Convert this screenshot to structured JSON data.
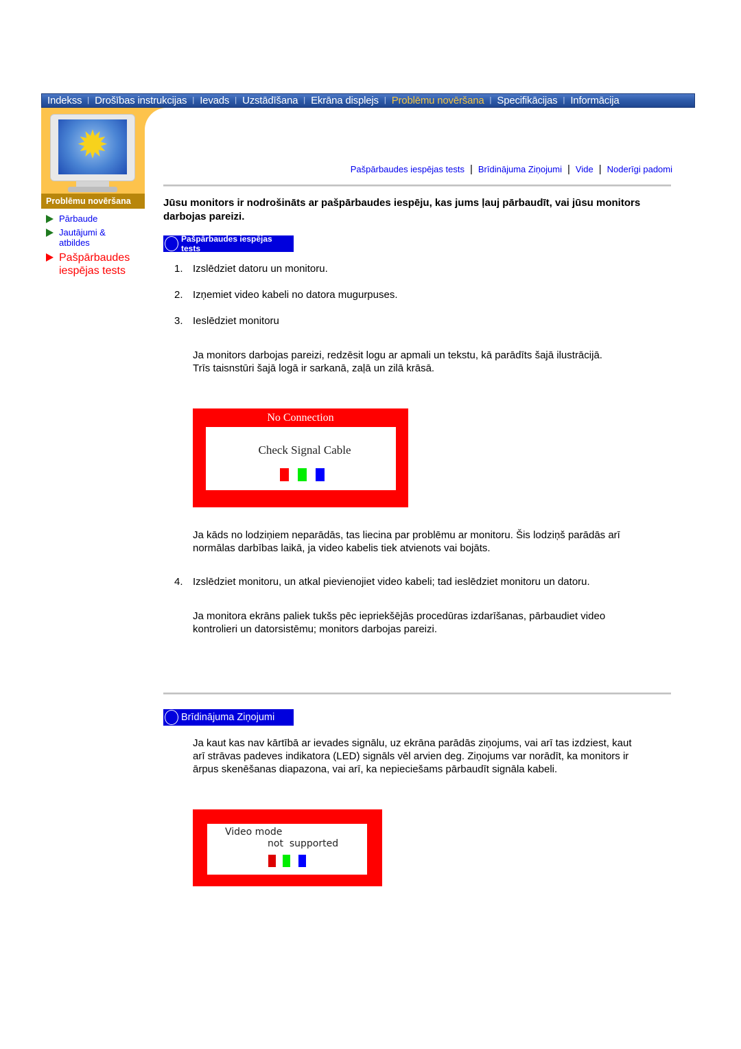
{
  "topnav": {
    "items": [
      {
        "label": "Indekss",
        "active": false
      },
      {
        "label": "Drošības instrukcijas",
        "active": false
      },
      {
        "label": "Ievads",
        "active": false
      },
      {
        "label": "Uzstādīšana",
        "active": false
      },
      {
        "label": "Ekrāna displejs",
        "active": false
      },
      {
        "label": "Problēmu novēršana",
        "active": true
      },
      {
        "label": "Specifikācijas",
        "active": false
      },
      {
        "label": "Informācija",
        "active": false
      }
    ],
    "separator": "|",
    "colors": {
      "bar": "#2d5aa8",
      "active_text": "#f4c542",
      "text": "#ffffff"
    }
  },
  "sidebar": {
    "section_label": "Problēmu novēršana",
    "image_icon": "monitor-with-sunflower",
    "items": [
      {
        "label": "Pārbaude",
        "active": false
      },
      {
        "label": "Jautājumi & atbildes",
        "active": false
      },
      {
        "label": "Pašpārbaudes iespējas tests",
        "active": true
      }
    ],
    "colors": {
      "panel": "#fdc34c",
      "label_bg": "#b8860b",
      "active": "#ff0000",
      "link": "#0000ee"
    }
  },
  "subnav": {
    "links": [
      "Pašpārbaudes iespējas tests",
      "Brīdinājuma Ziņojumi",
      "Vide",
      "Noderīgi padomi"
    ],
    "separator": "|"
  },
  "main": {
    "intro": "Jūsu monitors ir nodrošināts ar pašpārbaudes iespēju, kas jums ļauj pārbaudīt, vai jūsu monitors darbojas pareizi.",
    "section1": {
      "heading": "Pašpārbaudes iespējas tests",
      "steps": [
        {
          "num": "1.",
          "text": "Izslēdziet datoru un monitoru."
        },
        {
          "num": "2.",
          "text": "Izņemiet video kabeli no datora mugurpuses."
        },
        {
          "num": "3.",
          "text": "Ieslēdziet monitoru"
        }
      ],
      "para1_line1": "Ja monitors darbojas pareizi, redzēsit logu ar apmali un tekstu, kā parādīts šajā ilustrācijā.",
      "para1_line2": "Trīs taisnstūri šajā logā ir sarkanā, zaļā un zilā krāsā.",
      "osd1": {
        "title": "No Connection",
        "message": "Check Signal Cable",
        "squares": [
          "#ff0000",
          "#00ee00",
          "#0000ff"
        ]
      },
      "para2": "Ja kāds no lodziņiem neparādās, tas liecina par problēmu ar monitoru. Šis lodziņš parādās arī normālas darbības laikā, ja video kabelis tiek atvienots vai bojāts.",
      "step4": {
        "num": "4.",
        "text": "Izslēdziet monitoru, un atkal pievienojiet video kabeli; tad ieslēdziet monitoru un datoru."
      },
      "para3": "Ja monitora ekrāns paliek tukšs pēc iepriekšējās procedūras izdarīšanas, pārbaudiet video kontrolieri un datorsistēmu; monitors darbojas pareizi."
    },
    "section2": {
      "heading": "Brīdinājuma Ziņojumi",
      "para": "Ja kaut kas nav kārtībā ar ievades signālu, uz ekrāna parādās ziņojums, vai arī tas izdziest, kaut arī strāvas padeves indikatora (LED) signāls vēl arvien deg. Ziņojums var norādīt, ka monitors ir ārpus skenēšanas diapazona, vai arī, ka nepieciešams pārbaudīt signāla kabeli.",
      "osd2": {
        "line1": "Video mode",
        "line2": "not  supported",
        "squares": [
          "#dd0000",
          "#00ee00",
          "#0000ff"
        ]
      }
    },
    "colors": {
      "pill": "#0000dd",
      "osd_border": "#ff0000"
    }
  }
}
